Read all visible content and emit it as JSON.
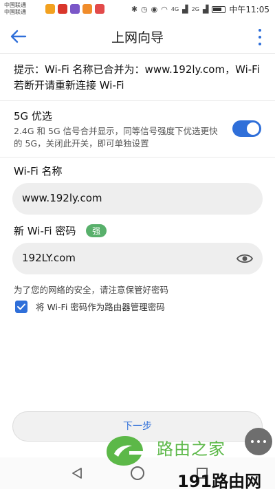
{
  "status_bar": {
    "carrier_1": "中国联通",
    "carrier_2": "中国联通",
    "signal_4g": "4G",
    "signal_2g": "2G",
    "time": "中午11:05",
    "app_icon_colors": [
      "#f2a11f",
      "#d9362b",
      "#7b57c8",
      "#f08c2a",
      "#e24a4a"
    ]
  },
  "app_bar": {
    "title": "上网向导",
    "back_icon": "arrow-left-icon",
    "menu_icon": "more-vert-icon",
    "accent_color": "#2f6fd9"
  },
  "notice": {
    "text": "提示：Wi-Fi 名称已合并为：www.192ly.com，Wi-Fi 若断开请重新连接 Wi-Fi"
  },
  "prefer_5g": {
    "title": "5G 优选",
    "description": "2.4G 和 5G 信号合并显示，同等信号强度下优选更快的 5G，关闭此开关，即可单独设置",
    "enabled": true
  },
  "wifi_name": {
    "label": "Wi-Fi 名称",
    "value": "www.192ly.com"
  },
  "wifi_password": {
    "label": "新 Wi-Fi 密码",
    "strength_badge": "强",
    "value": "192LY.com",
    "visibility_icon": "eye-icon"
  },
  "security_hint": "为了您的网络的安全，请注意保管好密码",
  "admin_checkbox": {
    "label": "将 Wi-Fi 密码作为路由器管理密码",
    "checked": true
  },
  "next_button": {
    "label": "下一步"
  },
  "watermark": {
    "brand_cn": "路由之家",
    "site": "191路由网"
  }
}
